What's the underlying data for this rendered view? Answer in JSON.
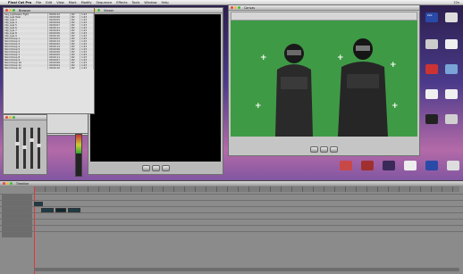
{
  "menubar": {
    "items": [
      "Final Cut Pro",
      "File",
      "Edit",
      "View",
      "Mark",
      "Modify",
      "Sequence",
      "Effects",
      "Tools",
      "Window",
      "Help"
    ],
    "clock": "22s"
  },
  "browser": {
    "title": "Browser",
    "rows": [
      [
        "Seq_Lightsaber Fight",
        "00:00:12",
        "DV",
        "1:23"
      ],
      [
        "Clip_Lyle Tank",
        "00:00:08",
        "DV",
        "1:23"
      ],
      [
        "Clip_Lyle 2",
        "00:00:05",
        "DV",
        "1:23"
      ],
      [
        "Clip_Lyle 4",
        "00:00:09",
        "DV",
        "1:23"
      ],
      [
        "Clip_Lyle 5",
        "00:00:07",
        "DV",
        "1:23"
      ],
      [
        "Clip_Lyle 6",
        "00:00:11",
        "DV",
        "1:23"
      ],
      [
        "Clip_Lyle 7",
        "00:00:04",
        "DV",
        "1:23"
      ],
      [
        "Clip_Lyle 8",
        "00:00:06",
        "DV",
        "1:23"
      ],
      [
        "Clip_Lyle 9",
        "00:00:10",
        "DV",
        "1:23"
      ],
      [
        "Stormtroop 1",
        "00:00:03",
        "DV",
        "1:23"
      ],
      [
        "Stormtroop 2",
        "00:00:13",
        "DV",
        "1:23"
      ],
      [
        "Stormtroop 3",
        "00:00:02",
        "DV",
        "1:23"
      ],
      [
        "Stormtroop 4",
        "00:00:14",
        "DV",
        "1:23"
      ],
      [
        "Stormtroop 5",
        "00:00:06",
        "DV",
        "1:23"
      ],
      [
        "Stormtroop 6",
        "00:00:09",
        "DV",
        "1:23"
      ],
      [
        "Stormtroop 7",
        "00:00:05",
        "DV",
        "1:23"
      ],
      [
        "Stormtroop 8",
        "00:00:11",
        "DV",
        "1:23"
      ],
      [
        "Stormtroop 9",
        "00:00:07",
        "DV",
        "1:23"
      ],
      [
        "Stormtroop 10",
        "00:00:08",
        "DV",
        "1:23"
      ],
      [
        "Stormtroop 11",
        "00:00:04",
        "DV",
        "1:23"
      ],
      [
        "Stormtroop 12",
        "00:00:10",
        "DV",
        "1:23"
      ]
    ]
  },
  "viewer": {
    "title": "Viewer"
  },
  "canvas": {
    "title": "Canvas"
  },
  "timeline": {
    "title": "Timeline"
  },
  "desktop_icons": [
    {
      "label": "22s"
    },
    {
      "label": "Camera"
    },
    {
      "label": "Macintosh HD"
    },
    {
      "label": "Desktop"
    },
    {
      "label": "Documents"
    },
    {
      "label": "Movies"
    },
    {
      "label": "Applications"
    },
    {
      "label": "Music"
    },
    {
      "label": "Pictures"
    },
    {
      "label": "Trash"
    }
  ],
  "colors": {
    "greenscreen": "#3f9a46",
    "clip_video": "#1c3c48",
    "clip_audio": "#2c5a1e"
  }
}
